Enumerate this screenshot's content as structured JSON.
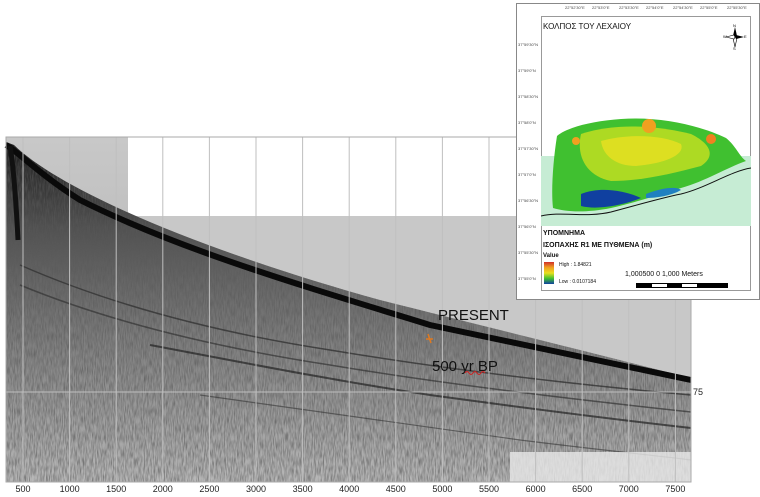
{
  "profile": {
    "x_ticks": [
      "500",
      "1000",
      "1500",
      "2000",
      "2500",
      "3000",
      "3500",
      "4000",
      "4500",
      "5000",
      "5500",
      "6000",
      "6500",
      "7000",
      "7500"
    ],
    "right_label": "75",
    "annotation_present": "PRESENT",
    "annotation_bp": "500 yr BP"
  },
  "map": {
    "title": "ΚΟΛΠΟΣ ΤΟΥ ΛΕΧΑΙΟΥ",
    "top_coords": [
      "22°52'30\"E",
      "22°53'0\"E",
      "22°53'30\"E",
      "22°54'0\"E",
      "22°54'30\"E",
      "22°55'0\"E",
      "22°55'30\"E"
    ],
    "left_coords": [
      "37°59'30\"N",
      "37°59'0\"N",
      "37°58'30\"N",
      "37°58'0\"N",
      "37°57'30\"N",
      "37°57'0\"N",
      "37°56'30\"N",
      "37°56'0\"N",
      "37°55'30\"N",
      "37°55'0\"N"
    ],
    "legend_title": "ΥΠΟΜΝΗΜΑ",
    "legend_layer": "ΙΣΟΠΑΧΗΣ R1 ΜΕ ΠΥΘΜΕΝΑ (m)",
    "legend_value": "Value",
    "legend_high": "High : 1.84821",
    "legend_low": "Low : 0.0107184",
    "scale_labels": "1,000500   0             1,000 Meters",
    "north_letters": {
      "n": "N",
      "s": "S",
      "e": "E",
      "w": "W"
    },
    "colors": {
      "land": "#c6ecd4",
      "high": "#d0302a",
      "mid": "#e8e020",
      "green": "#40c030",
      "low": "#1040a0"
    }
  }
}
